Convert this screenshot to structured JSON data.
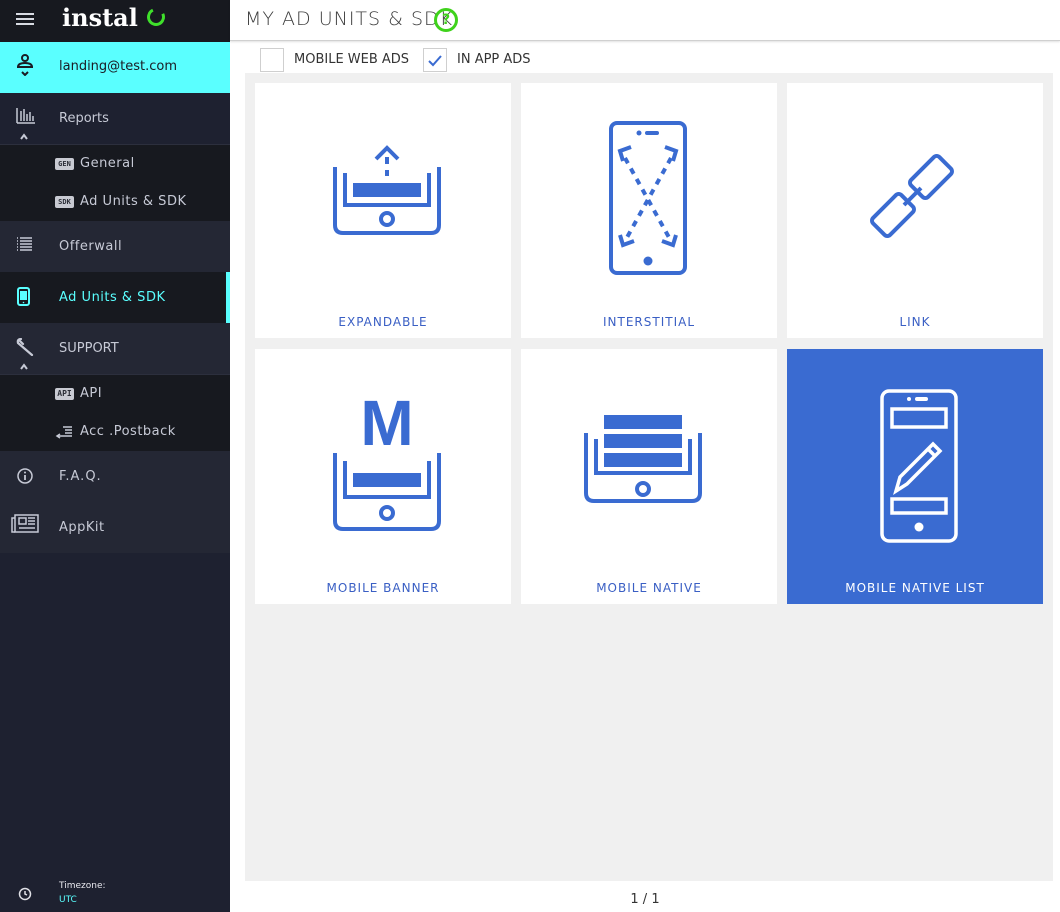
{
  "app": {
    "logo_text": "instal"
  },
  "sidebar": {
    "user_email": "landing@test.com",
    "reports": {
      "label": "Reports",
      "children": [
        {
          "badge": "GEN",
          "label": "General"
        },
        {
          "badge": "SDK",
          "label": "Ad Units & SDK"
        }
      ]
    },
    "offerwall": {
      "label": "Offerwall"
    },
    "ad_units": {
      "label": "Ad Units & SDK",
      "active": true
    },
    "support": {
      "label": "SUPPORT",
      "children": [
        {
          "badge": "API",
          "label": "API"
        },
        {
          "label": "Acc .Postback"
        }
      ]
    },
    "faq": {
      "label": "F.A.Q."
    },
    "appkit": {
      "label": "AppKit"
    },
    "timezone": {
      "label": "Timezone:",
      "value": "UTC"
    }
  },
  "header": {
    "title": "MY AD UNITS & SDK",
    "help_glyph": "?"
  },
  "filters": [
    {
      "label": "MOBILE WEB ADS",
      "checked": false
    },
    {
      "label": "IN APP ADS",
      "checked": true
    }
  ],
  "tiles": [
    {
      "label": "EXPANDABLE",
      "icon": "expandable-icon",
      "selected": false
    },
    {
      "label": "INTERSTITIAL",
      "icon": "interstitial-icon",
      "selected": false
    },
    {
      "label": "LINK",
      "icon": "link-icon",
      "selected": false
    },
    {
      "label": "MOBILE BANNER",
      "icon": "mobile-banner-icon",
      "selected": false,
      "glyph": "M"
    },
    {
      "label": "MOBILE NATIVE",
      "icon": "mobile-native-icon",
      "selected": false
    },
    {
      "label": "MOBILE NATIVE LIST",
      "icon": "mobile-native-list-icon",
      "selected": true
    }
  ],
  "pagination": {
    "text": "1 / 1"
  },
  "colors": {
    "accent": "#5affff",
    "brand_green": "#3fd21b",
    "tile_blue": "#3a6bd1",
    "sidebar_bg": "#1e2130"
  }
}
